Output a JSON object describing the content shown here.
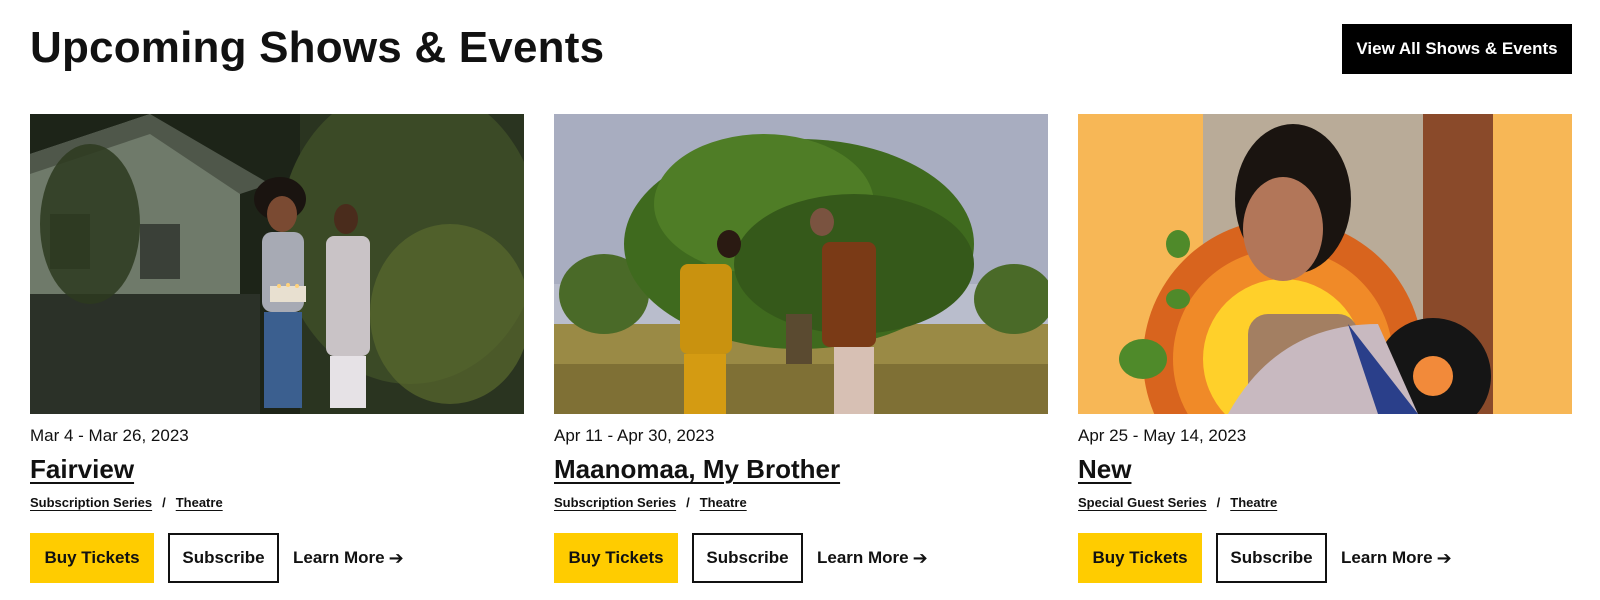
{
  "header": {
    "title": "Upcoming Shows & Events",
    "view_all_label": "View All Shows & Events"
  },
  "cards": [
    {
      "date": "Mar 4 - Mar 26, 2023",
      "title": "Fairview",
      "tag1": "Subscription Series",
      "separator": "/",
      "tag2": "Theatre",
      "buy_label": "Buy Tickets",
      "subscribe_label": "Subscribe",
      "learn_label": "Learn More",
      "arrow": "➔"
    },
    {
      "date": "Apr 11 - Apr 30, 2023",
      "title": "Maanomaa, My Brother",
      "tag1": "Subscription Series",
      "separator": "/",
      "tag2": "Theatre",
      "buy_label": "Buy Tickets",
      "subscribe_label": "Subscribe",
      "learn_label": "Learn More",
      "arrow": "➔"
    },
    {
      "date": "Apr 25 - May 14, 2023",
      "title": "New",
      "tag1": "Special Guest Series",
      "separator": "/",
      "tag2": "Theatre",
      "buy_label": "Buy Tickets",
      "subscribe_label": "Subscribe",
      "learn_label": "Learn More",
      "arrow": "➔"
    }
  ],
  "colors": {
    "accent_yellow": "#ffcc00",
    "button_dark": "#000000",
    "text": "#111111"
  }
}
